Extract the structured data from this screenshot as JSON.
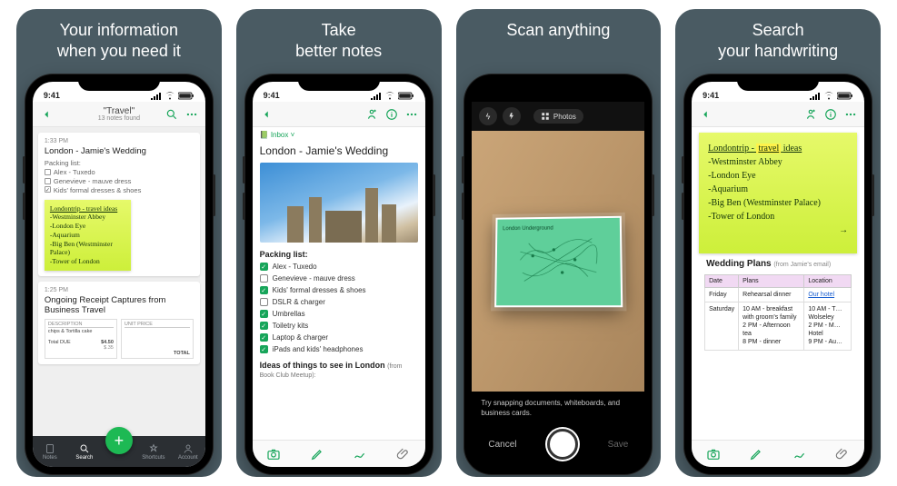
{
  "panels": [
    {
      "title": "Your information\nwhen you need it"
    },
    {
      "title": "Take\nbetter notes"
    },
    {
      "title": "Scan anything"
    },
    {
      "title": "Search\nyour handwriting"
    }
  ],
  "status": {
    "time": "9:41"
  },
  "colors": {
    "accent": "#17a55a",
    "fab": "#1db954",
    "panel_bg": "#4a5b63"
  },
  "screen1": {
    "nav": {
      "title": "\"Travel\"",
      "subtitle": "13 notes found"
    },
    "cards": [
      {
        "time": "1:33 PM",
        "title": "London - Jamie's Wedding",
        "packing_label": "Packing list:",
        "items": [
          {
            "text": "Alex - Tuxedo",
            "checked": false
          },
          {
            "text": "Genevieve - mauve dress",
            "checked": false
          },
          {
            "text": "Kids' formal dresses & shoes",
            "checked": true
          }
        ],
        "sticky": {
          "heading": "Londontrip - travel ideas",
          "lines": [
            "-Westminster Abbey",
            "-London Eye",
            "-Aquarium",
            "-Big Ben (Westminster Palace)",
            "-Tower of London"
          ]
        }
      },
      {
        "time": "1:25 PM",
        "title": "Ongoing Receipt Captures from Business Travel",
        "receipt": {
          "col_desc": "DESCRIPTION",
          "col_price": "UNIT PRICE",
          "rows": [
            "chips & Tortilla cake"
          ],
          "total_label": "TOTAL",
          "total": "$4.50",
          "sub": "$.35"
        }
      }
    ],
    "tabs": [
      "Notes",
      "Search",
      "",
      "Shortcuts",
      "Account"
    ]
  },
  "screen2": {
    "notebook": "Inbox",
    "title": "London - Jamie's Wedding",
    "packing_header": "Packing list:",
    "checklist": [
      {
        "text": "Alex - Tuxedo",
        "checked": true
      },
      {
        "text": "Genevieve - mauve dress",
        "checked": false
      },
      {
        "text": "Kids' formal dresses & shoes",
        "checked": true
      },
      {
        "text": "DSLR & charger",
        "checked": false
      },
      {
        "text": "Umbrellas",
        "checked": true
      },
      {
        "text": "Toiletry kits",
        "checked": true
      },
      {
        "text": "Laptop & charger",
        "checked": true
      },
      {
        "text": "iPads and kids' headphones",
        "checked": true
      }
    ],
    "ideas_header": "Ideas of things to see in London",
    "ideas_from": "(from Book Club Meetup):"
  },
  "screen3": {
    "mode_label": "Photos",
    "doc_label": "London Underground",
    "hint": "Try snapping documents, whiteboards, and business cards.",
    "cancel": "Cancel",
    "save": "Save"
  },
  "screen4": {
    "sticky": {
      "heading_pre": "Londontrip -",
      "heading_hl": "travel",
      "heading_post": "ideas",
      "lines": [
        "-Westminster Abbey",
        "-London Eye",
        "-Aquarium",
        "-Big Ben (Westminster Palace)",
        "-Tower of London"
      ]
    },
    "plans_title": "Wedding Plans",
    "plans_from": "(from Jamie's email)",
    "table": {
      "headers": [
        "Date",
        "Plans",
        "Location"
      ],
      "rows": [
        {
          "date": "Friday",
          "plans": "Rehearsal dinner",
          "loc_link": "Our hotel"
        },
        {
          "date": "Saturday",
          "plans": "10 AM - breakfast with groom's family\n2 PM - Afternoon tea\n8 PM - dinner",
          "loc": "10 AM - T… Wolseley\n2 PM - M… Hotel\n9 PM - Au…"
        }
      ]
    }
  }
}
